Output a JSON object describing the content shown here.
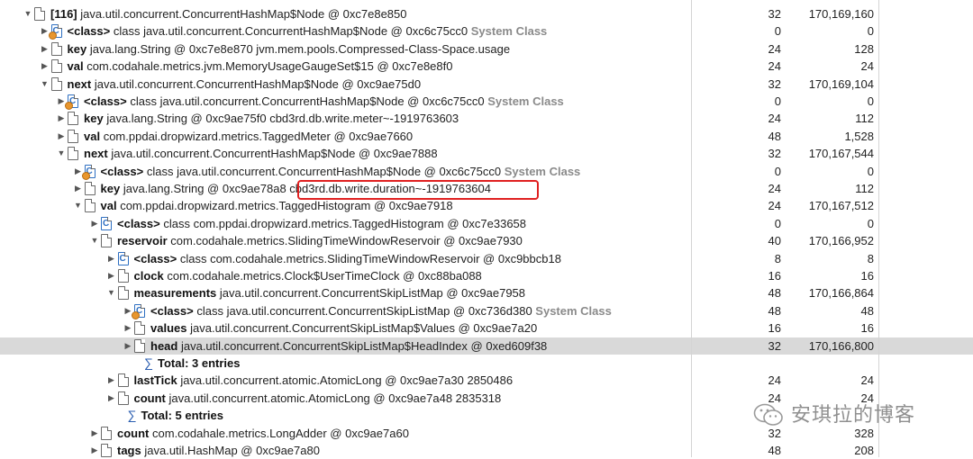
{
  "rows": [
    {
      "indent": 0,
      "expanded": true,
      "kind": "obj",
      "name": "[116]",
      "desc": "java.util.concurrent.ConcurrentHashMap$Node @ 0xc7e8e850",
      "sys": "",
      "shallow": "32",
      "retained": "170,169,160"
    },
    {
      "indent": 1,
      "expanded": false,
      "kind": "cls",
      "name": "<class>",
      "desc": "class java.util.concurrent.ConcurrentHashMap$Node @ 0xc6c75cc0",
      "sys": "System Class",
      "shallow": "0",
      "retained": "0"
    },
    {
      "indent": 1,
      "expanded": false,
      "kind": "obj",
      "name": "key",
      "desc": "java.lang.String @ 0xc7e8e870  jvm.mem.pools.Compressed-Class-Space.usage",
      "sys": "",
      "shallow": "24",
      "retained": "128"
    },
    {
      "indent": 1,
      "expanded": false,
      "kind": "obj",
      "name": "val",
      "desc": "com.codahale.metrics.jvm.MemoryUsageGaugeSet$15 @ 0xc7e8e8f0",
      "sys": "",
      "shallow": "24",
      "retained": "24"
    },
    {
      "indent": 1,
      "expanded": true,
      "kind": "obj",
      "name": "next",
      "desc": "java.util.concurrent.ConcurrentHashMap$Node @ 0xc9ae75d0",
      "sys": "",
      "shallow": "32",
      "retained": "170,169,104"
    },
    {
      "indent": 2,
      "expanded": false,
      "kind": "cls",
      "name": "<class>",
      "desc": "class java.util.concurrent.ConcurrentHashMap$Node @ 0xc6c75cc0",
      "sys": "System Class",
      "shallow": "0",
      "retained": "0"
    },
    {
      "indent": 2,
      "expanded": false,
      "kind": "obj",
      "name": "key",
      "desc": "java.lang.String @ 0xc9ae75f0  cbd3rd.db.write.meter~-1919763603",
      "sys": "",
      "shallow": "24",
      "retained": "112"
    },
    {
      "indent": 2,
      "expanded": false,
      "kind": "obj",
      "name": "val",
      "desc": "com.ppdai.dropwizard.metrics.TaggedMeter @ 0xc9ae7660",
      "sys": "",
      "shallow": "48",
      "retained": "1,528"
    },
    {
      "indent": 2,
      "expanded": true,
      "kind": "obj",
      "name": "next",
      "desc": "java.util.concurrent.ConcurrentHashMap$Node @ 0xc9ae7888",
      "sys": "",
      "shallow": "32",
      "retained": "170,167,544"
    },
    {
      "indent": 3,
      "expanded": false,
      "kind": "cls",
      "name": "<class>",
      "desc": "class java.util.concurrent.ConcurrentHashMap$Node @ 0xc6c75cc0",
      "sys": "System Class",
      "shallow": "0",
      "retained": "0"
    },
    {
      "indent": 3,
      "expanded": false,
      "kind": "obj",
      "name": "key",
      "desc": "java.lang.String @ 0xc9ae78a8  cbd3rd.db.write.duration~-1919763604",
      "sys": "",
      "shallow": "24",
      "retained": "112"
    },
    {
      "indent": 3,
      "expanded": true,
      "kind": "obj",
      "name": "val",
      "desc": "com.ppdai.dropwizard.metrics.TaggedHistogram @ 0xc9ae7918",
      "sys": "",
      "shallow": "24",
      "retained": "170,167,512"
    },
    {
      "indent": 4,
      "expanded": false,
      "kind": "cls",
      "name": "<class>",
      "desc": "class com.ppdai.dropwizard.metrics.TaggedHistogram @ 0xc7e33658",
      "sys": "",
      "shallow": "0",
      "retained": "0"
    },
    {
      "indent": 4,
      "expanded": true,
      "kind": "obj",
      "name": "reservoir",
      "desc": "com.codahale.metrics.SlidingTimeWindowReservoir @ 0xc9ae7930",
      "sys": "",
      "shallow": "40",
      "retained": "170,166,952"
    },
    {
      "indent": 5,
      "expanded": false,
      "kind": "cls",
      "name": "<class>",
      "desc": "class com.codahale.metrics.SlidingTimeWindowReservoir @ 0xc9bbcb18",
      "sys": "",
      "shallow": "8",
      "retained": "8"
    },
    {
      "indent": 5,
      "expanded": false,
      "kind": "obj",
      "name": "clock",
      "desc": "com.codahale.metrics.Clock$UserTimeClock @ 0xc88ba088",
      "sys": "",
      "shallow": "16",
      "retained": "16"
    },
    {
      "indent": 5,
      "expanded": true,
      "kind": "obj",
      "name": "measurements",
      "desc": "java.util.concurrent.ConcurrentSkipListMap @ 0xc9ae7958",
      "sys": "",
      "shallow": "48",
      "retained": "170,166,864"
    },
    {
      "indent": 6,
      "expanded": false,
      "kind": "cls",
      "name": "<class>",
      "desc": "class java.util.concurrent.ConcurrentSkipListMap @ 0xc736d380",
      "sys": "System Class",
      "shallow": "48",
      "retained": "48"
    },
    {
      "indent": 6,
      "expanded": false,
      "kind": "obj",
      "name": "values",
      "desc": "java.util.concurrent.ConcurrentSkipListMap$Values @ 0xc9ae7a20",
      "sys": "",
      "shallow": "16",
      "retained": "16"
    },
    {
      "indent": 6,
      "expanded": false,
      "kind": "obj",
      "name": "head",
      "desc": "java.util.concurrent.ConcurrentSkipListMap$HeadIndex @ 0xed609f38",
      "sys": "",
      "shallow": "32",
      "retained": "170,166,800",
      "selected": true
    },
    {
      "indent": 6,
      "expanded": null,
      "kind": "total",
      "name": "Total: 3 entries",
      "desc": "",
      "sys": "",
      "shallow": "",
      "retained": ""
    },
    {
      "indent": 5,
      "expanded": false,
      "kind": "obj",
      "name": "lastTick",
      "desc": "java.util.concurrent.atomic.AtomicLong @ 0xc9ae7a30  2850486",
      "sys": "",
      "shallow": "24",
      "retained": "24"
    },
    {
      "indent": 5,
      "expanded": false,
      "kind": "obj",
      "name": "count",
      "desc": "java.util.concurrent.atomic.AtomicLong @ 0xc9ae7a48  2835318",
      "sys": "",
      "shallow": "24",
      "retained": "24"
    },
    {
      "indent": 5,
      "expanded": null,
      "kind": "total",
      "name": "Total: 5 entries",
      "desc": "",
      "sys": "",
      "shallow": "",
      "retained": ""
    },
    {
      "indent": 4,
      "expanded": false,
      "kind": "obj",
      "name": "count",
      "desc": "com.codahale.metrics.LongAdder @ 0xc9ae7a60",
      "sys": "",
      "shallow": "32",
      "retained": "328"
    },
    {
      "indent": 4,
      "expanded": false,
      "kind": "obj",
      "name": "tags",
      "desc": "java.util.HashMap @ 0xc9ae7a80",
      "sys": "",
      "shallow": "48",
      "retained": "208"
    }
  ],
  "highlight_text": "cbd3rd.db.write.duration~-1919763604",
  "watermark": {
    "icon": "wechat-icon",
    "text": "安琪拉的博客"
  },
  "colors": {
    "highlight_border": "#e02020",
    "selected_row": "#d9d9d9",
    "system_class": "#8a8a8a"
  }
}
